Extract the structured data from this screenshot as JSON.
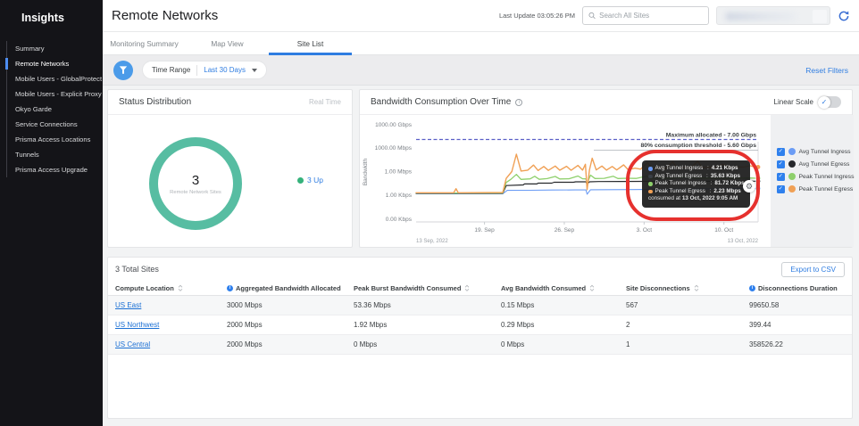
{
  "colors": {
    "accent_blue": "#2f7de1",
    "donut_teal": "#57bda2",
    "up_green": "#35b27b",
    "max_line_purple": "#5b5fc7",
    "annotation_red": "#e6312e"
  },
  "sidebar": {
    "title": "Insights",
    "items": [
      {
        "label": "Summary",
        "active": false
      },
      {
        "label": "Remote Networks",
        "active": true
      },
      {
        "label": "Mobile Users - GlobalProtect",
        "active": false
      },
      {
        "label": "Mobile Users - Explicit Proxy",
        "active": false
      },
      {
        "label": "Okyo Garde",
        "active": false
      },
      {
        "label": "Service Connections",
        "active": false
      },
      {
        "label": "Prisma Access Locations",
        "active": false
      },
      {
        "label": "Tunnels",
        "active": false
      },
      {
        "label": "Prisma Access Upgrade",
        "active": false
      }
    ]
  },
  "header": {
    "title": "Remote Networks",
    "last_update": "Last Update 03:05:26 PM",
    "search_placeholder": "Search All Sites"
  },
  "tabs": [
    {
      "label": "Monitoring Summary",
      "active": false
    },
    {
      "label": "Map View",
      "active": false
    },
    {
      "label": "Site List",
      "active": true
    }
  ],
  "filter_bar": {
    "time_range_label": "Time Range",
    "time_range_value": "Last 30 Days",
    "reset_label": "Reset Filters"
  },
  "status_card": {
    "title": "Status Distribution",
    "badge": "Real Time",
    "count": "3",
    "count_label": "Remote Network Sites",
    "legend_label": "3 Up"
  },
  "bandwidth_card": {
    "title": "Bandwidth Consumption Over Time",
    "scale_toggle_label": "Linear Scale",
    "tooltip": {
      "rows": [
        {
          "label": "Avg Tunnel Ingress",
          "value": "4.21 Kbps",
          "color": "#6b9cf5"
        },
        {
          "label": "Avg Tunnel Egress",
          "value": "35.63 Kbps",
          "color": "#3a3f45"
        },
        {
          "label": "Peak Tunnel Ingress",
          "value": "81.72 Kbps",
          "color": "#8ed06c"
        },
        {
          "label": "Peak Tunnel Egress",
          "value": "2.23 Mbps",
          "color": "#f0a055"
        }
      ],
      "footer_prefix": "consumed at ",
      "footer_time": "13 Oct, 2022 9:05 AM"
    }
  },
  "chart_data": {
    "type": "line",
    "title": "Bandwidth Consumption Over Time",
    "x_axis": {
      "start_label": "13 Sep, 2022",
      "end_label": "13 Oct, 2022",
      "ticks": [
        "19. Sep",
        "26. Sep",
        "3. Oct",
        "10. Oct"
      ],
      "tick_days": [
        6,
        13,
        20,
        27
      ],
      "range_days": 30
    },
    "y_axis": {
      "label": "Bandwidth",
      "scale": "log",
      "ticks": [
        "1000.00 Gbps",
        "1000.00 Mbps",
        "1.00 Mbps",
        "1.00 Kbps",
        "0.00 Kbps"
      ]
    },
    "annotations": [
      {
        "label": "Maximum allocated - 7.00 Gbps",
        "value_kbps": 7000000,
        "style": "dashed",
        "color": "#5b5fc7"
      },
      {
        "label": "80% consumption threshold - 5.60 Gbps",
        "value_kbps": 5600000,
        "style": "thin",
        "color": "#9aa0a6"
      }
    ],
    "legend": [
      {
        "label": "Avg Tunnel Ingress",
        "color": "#6b9cf5",
        "checked": true
      },
      {
        "label": "Avg Tunnel Egress",
        "color": "#26282c",
        "checked": true
      },
      {
        "label": "Peak Tunnel Ingress",
        "color": "#8ed06c",
        "checked": true
      },
      {
        "label": "Peak Tunnel Egress",
        "color": "#f0a055",
        "checked": true
      }
    ],
    "series": [
      {
        "name": "Avg Tunnel Ingress",
        "color": "#6b9cf5",
        "width": 1.1,
        "points_day_kbps": [
          [
            0,
            0.9
          ],
          [
            7.6,
            0.9
          ],
          [
            8,
            2.4
          ],
          [
            10,
            2.5
          ],
          [
            12,
            2.7
          ],
          [
            14,
            2.8
          ],
          [
            14.9,
            2.8
          ],
          [
            15,
            0.8
          ],
          [
            15.3,
            2.9
          ],
          [
            17,
            3
          ],
          [
            19,
            3.1
          ],
          [
            21,
            3.3
          ],
          [
            23,
            3.5
          ],
          [
            25,
            3.7
          ],
          [
            27,
            3.9
          ],
          [
            29,
            4.1
          ],
          [
            30,
            4.21
          ]
        ]
      },
      {
        "name": "Avg Tunnel Egress",
        "color": "#26282c",
        "width": 1.2,
        "points_day_kbps": [
          [
            0,
            1
          ],
          [
            7.6,
            1
          ],
          [
            7.9,
            10
          ],
          [
            9.4,
            12
          ],
          [
            9.5,
            16
          ],
          [
            10.6,
            16
          ],
          [
            10.7,
            20
          ],
          [
            11.9,
            20
          ],
          [
            12.1,
            26
          ],
          [
            13.8,
            26
          ],
          [
            14,
            30
          ],
          [
            14.9,
            30
          ],
          [
            15,
            15
          ],
          [
            15.2,
            30
          ],
          [
            16,
            32
          ],
          [
            18,
            33
          ],
          [
            20,
            34
          ],
          [
            24,
            35
          ],
          [
            28,
            35
          ],
          [
            30,
            35.63
          ]
        ]
      },
      {
        "name": "Peak Tunnel Ingress",
        "color": "#8ed06c",
        "width": 1.3,
        "points_day_kbps": [
          [
            0,
            1.1
          ],
          [
            7.6,
            1.1
          ],
          [
            7.9,
            25
          ],
          [
            8.3,
            60
          ],
          [
            8.8,
            260
          ],
          [
            9.2,
            60
          ],
          [
            10,
            70
          ],
          [
            10.4,
            150
          ],
          [
            10.8,
            62
          ],
          [
            11.5,
            75
          ],
          [
            12.2,
            140
          ],
          [
            12.6,
            68
          ],
          [
            13.4,
            72
          ],
          [
            14.2,
            160
          ],
          [
            14.6,
            72
          ],
          [
            14.9,
            70
          ],
          [
            15,
            18
          ],
          [
            15.3,
            210
          ],
          [
            15.7,
            78
          ],
          [
            16.5,
            82
          ],
          [
            17.3,
            150
          ],
          [
            17.7,
            78
          ],
          [
            18.5,
            84
          ],
          [
            19.3,
            80
          ],
          [
            20.2,
            150
          ],
          [
            20.6,
            82
          ],
          [
            21.5,
            88
          ],
          [
            22.5,
            84
          ],
          [
            23.5,
            120
          ],
          [
            24.5,
            86
          ],
          [
            25.5,
            90
          ],
          [
            26.5,
            86
          ],
          [
            27.5,
            92
          ],
          [
            28.5,
            86
          ],
          [
            29.3,
            90
          ],
          [
            30,
            81.72
          ]
        ]
      },
      {
        "name": "Peak Tunnel Egress",
        "color": "#f0a055",
        "width": 1.4,
        "points_day_kbps": [
          [
            0,
            1.2
          ],
          [
            3.3,
            1.2
          ],
          [
            3.5,
            4
          ],
          [
            3.7,
            1.2
          ],
          [
            7.6,
            1.3
          ],
          [
            7.9,
            80
          ],
          [
            8.4,
            600
          ],
          [
            8.8,
            95000
          ],
          [
            9.2,
            700
          ],
          [
            9.8,
            900
          ],
          [
            10.3,
            4000
          ],
          [
            10.7,
            820
          ],
          [
            11.2,
            2600
          ],
          [
            11.6,
            830
          ],
          [
            12.2,
            3000
          ],
          [
            12.6,
            880
          ],
          [
            13.2,
            2800
          ],
          [
            13.6,
            860
          ],
          [
            14.2,
            3600
          ],
          [
            14.6,
            900
          ],
          [
            14.85,
            5000
          ],
          [
            15,
            3
          ],
          [
            15.2,
            900
          ],
          [
            15.45,
            30000
          ],
          [
            15.8,
            950
          ],
          [
            16.3,
            3000
          ],
          [
            16.7,
            900
          ],
          [
            17.2,
            2600
          ],
          [
            17.6,
            950
          ],
          [
            18.2,
            4200
          ],
          [
            18.6,
            1000
          ],
          [
            19.2,
            1600
          ],
          [
            19.7,
            1200
          ],
          [
            20.3,
            8000
          ],
          [
            20.7,
            1300
          ],
          [
            21.3,
            2100
          ],
          [
            21.9,
            1500
          ],
          [
            22.5,
            10000
          ],
          [
            22.9,
            1500
          ],
          [
            23.5,
            2100
          ],
          [
            24.1,
            1800
          ],
          [
            24.7,
            12000
          ],
          [
            25.1,
            1900
          ],
          [
            25.7,
            2200
          ],
          [
            26.3,
            2000
          ],
          [
            26.9,
            5000
          ],
          [
            27.5,
            2100
          ],
          [
            28.1,
            2300
          ],
          [
            28.7,
            2200
          ],
          [
            29.3,
            3200
          ],
          [
            29.7,
            2280
          ],
          [
            30,
            2230
          ]
        ]
      }
    ]
  },
  "table": {
    "title": "3 Total Sites",
    "export_label": "Export to CSV",
    "columns": [
      {
        "label": "Compute Location",
        "sort": true,
        "info": false
      },
      {
        "label": "Aggregated Bandwidth Allocated",
        "sort": false,
        "info": true
      },
      {
        "label": "Peak Burst Bandwidth Consumed",
        "sort": true,
        "info": false
      },
      {
        "label": "Avg Bandwidth Consumed",
        "sort": true,
        "info": false
      },
      {
        "label": "Site Disconnections",
        "sort": true,
        "info": false
      },
      {
        "label": "Disconnections Duration",
        "sort": false,
        "info": true
      }
    ],
    "rows": [
      [
        "US East",
        "3000 Mbps",
        "53.36 Mbps",
        "0.15 Mbps",
        "567",
        "99650.58"
      ],
      [
        "US Northwest",
        "2000 Mbps",
        "1.92 Mbps",
        "0.29 Mbps",
        "2",
        "399.44"
      ],
      [
        "US Central",
        "2000 Mbps",
        "0 Mbps",
        "0 Mbps",
        "1",
        "358526.22"
      ]
    ]
  }
}
